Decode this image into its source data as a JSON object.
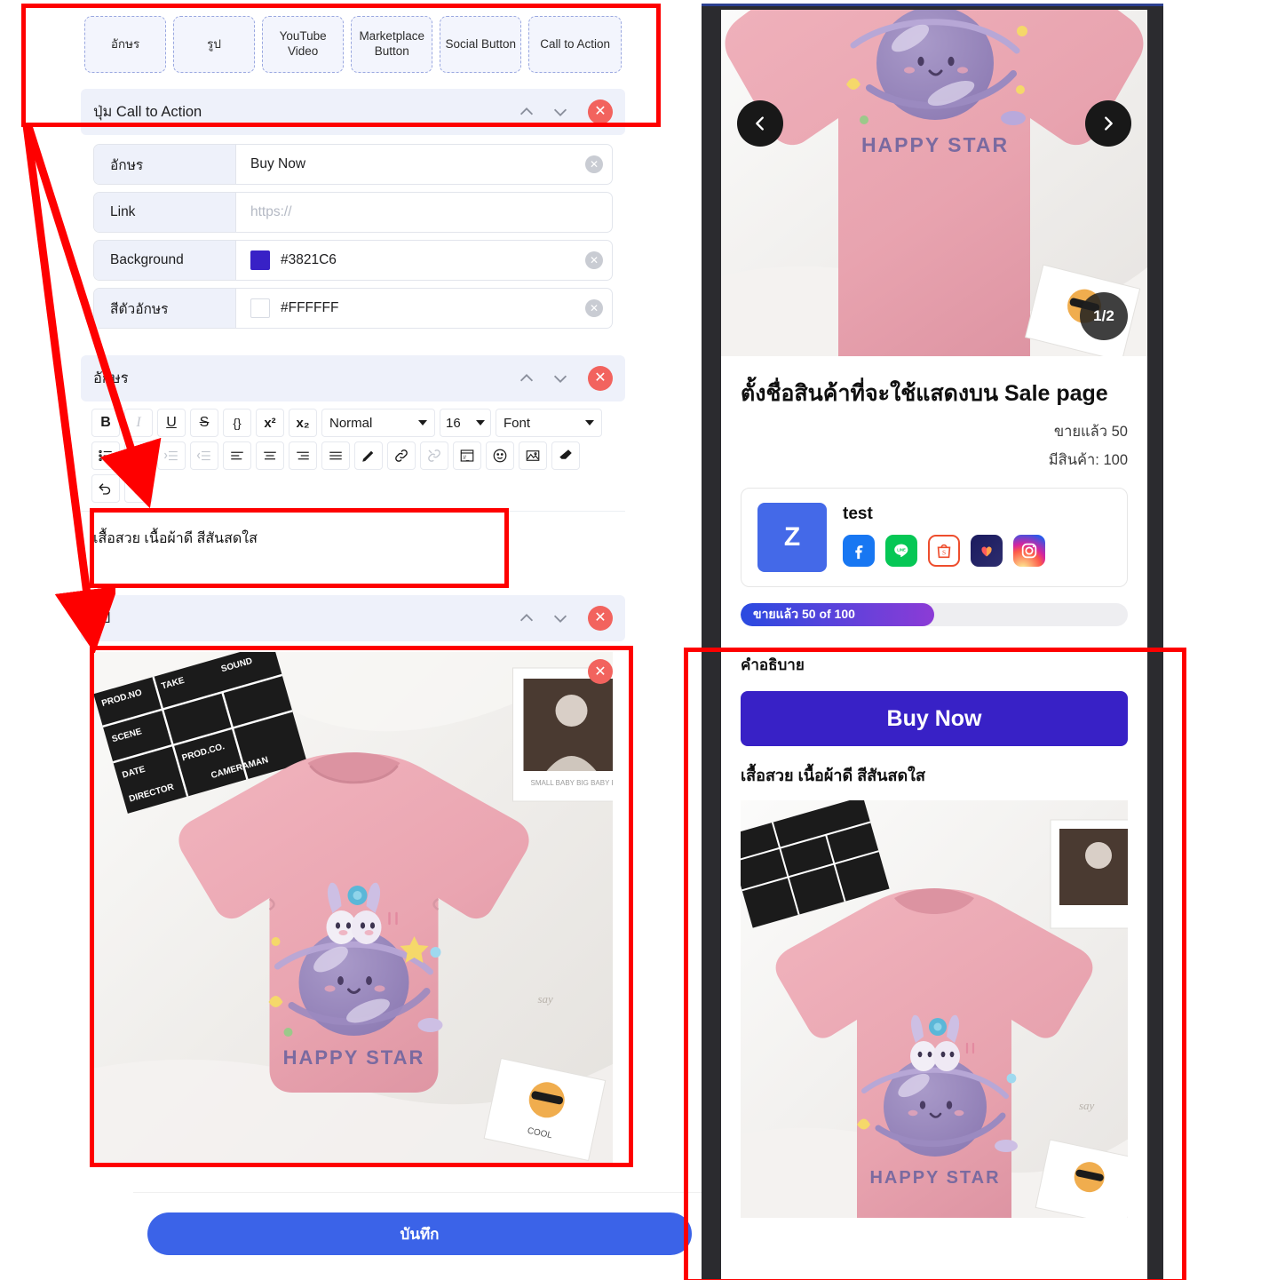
{
  "editor": {
    "block_types": [
      {
        "label": "อักษร",
        "name": "text"
      },
      {
        "label": "รูป",
        "name": "image"
      },
      {
        "label": "YouTube Video",
        "name": "youtube-video"
      },
      {
        "label": "Marketplace Button",
        "name": "marketplace-button"
      },
      {
        "label": "Social Button",
        "name": "social-button"
      },
      {
        "label": "Call to Action",
        "name": "call-to-action"
      }
    ],
    "cta_section": {
      "title": "ปุ่ม Call to Action",
      "fields": [
        {
          "label": "อักษร",
          "value": "Buy Now",
          "placeholder": "",
          "has_clear": true,
          "swatch": ""
        },
        {
          "label": "Link",
          "value": "",
          "placeholder": "https://",
          "has_clear": false,
          "swatch": ""
        },
        {
          "label": "Background",
          "value": "#3821C6",
          "placeholder": "",
          "has_clear": true,
          "swatch": "#3821C6"
        },
        {
          "label": "สีตัวอักษร",
          "value": "#FFFFFF",
          "placeholder": "",
          "has_clear": true,
          "swatch": "#FFFFFF"
        }
      ]
    },
    "text_section": {
      "title": "อักษร",
      "toolbar": {
        "bold": "B",
        "italic": "I",
        "underline": "U",
        "strike": "S",
        "code": "{}",
        "superscript": "x²",
        "subscript": "x₂",
        "block_style": "Normal",
        "font_size": "16",
        "font_family": "Font"
      },
      "content": "เสื้อสวย เนื้อผ้าดี สีสันสดใส"
    },
    "image_section": {
      "title": "รูป"
    },
    "save_label": "บันทึก"
  },
  "preview": {
    "carousel": {
      "counter": "1/2",
      "prev": "prev-slide",
      "next": "next-slide"
    },
    "product_title": "ตั้งชื่อสินค้าที่จะใช้แสดงบน Sale page",
    "sold_label": "ขายแล้ว 50",
    "stock_label": "มีสินค้า: 100",
    "shop": {
      "avatar_letter": "Z",
      "name": "test",
      "socials": [
        "facebook",
        "line",
        "shopee",
        "lazada",
        "instagram"
      ]
    },
    "progress": {
      "label": "ขายแล้ว 50 of 100",
      "percent": 50
    },
    "description_label": "คำอธิบาย",
    "cta": {
      "label": "Buy Now",
      "background": "#3821C6",
      "text_color": "#FFFFFF"
    },
    "body_text": "เสื้อสวย เนื้อผ้าดี สีสันสดใส"
  },
  "product_art": {
    "shirt_color": "#eeaab4",
    "print_caption": "HAPPY STAR",
    "clapper_labels": [
      "PROD.NO",
      "TAKE",
      "SOUND",
      "SCENE",
      "DATE",
      "PROD.CO.",
      "DIRECTOR",
      "CAMERAMAN"
    ]
  },
  "annotation": {
    "color": "#FE0000"
  }
}
